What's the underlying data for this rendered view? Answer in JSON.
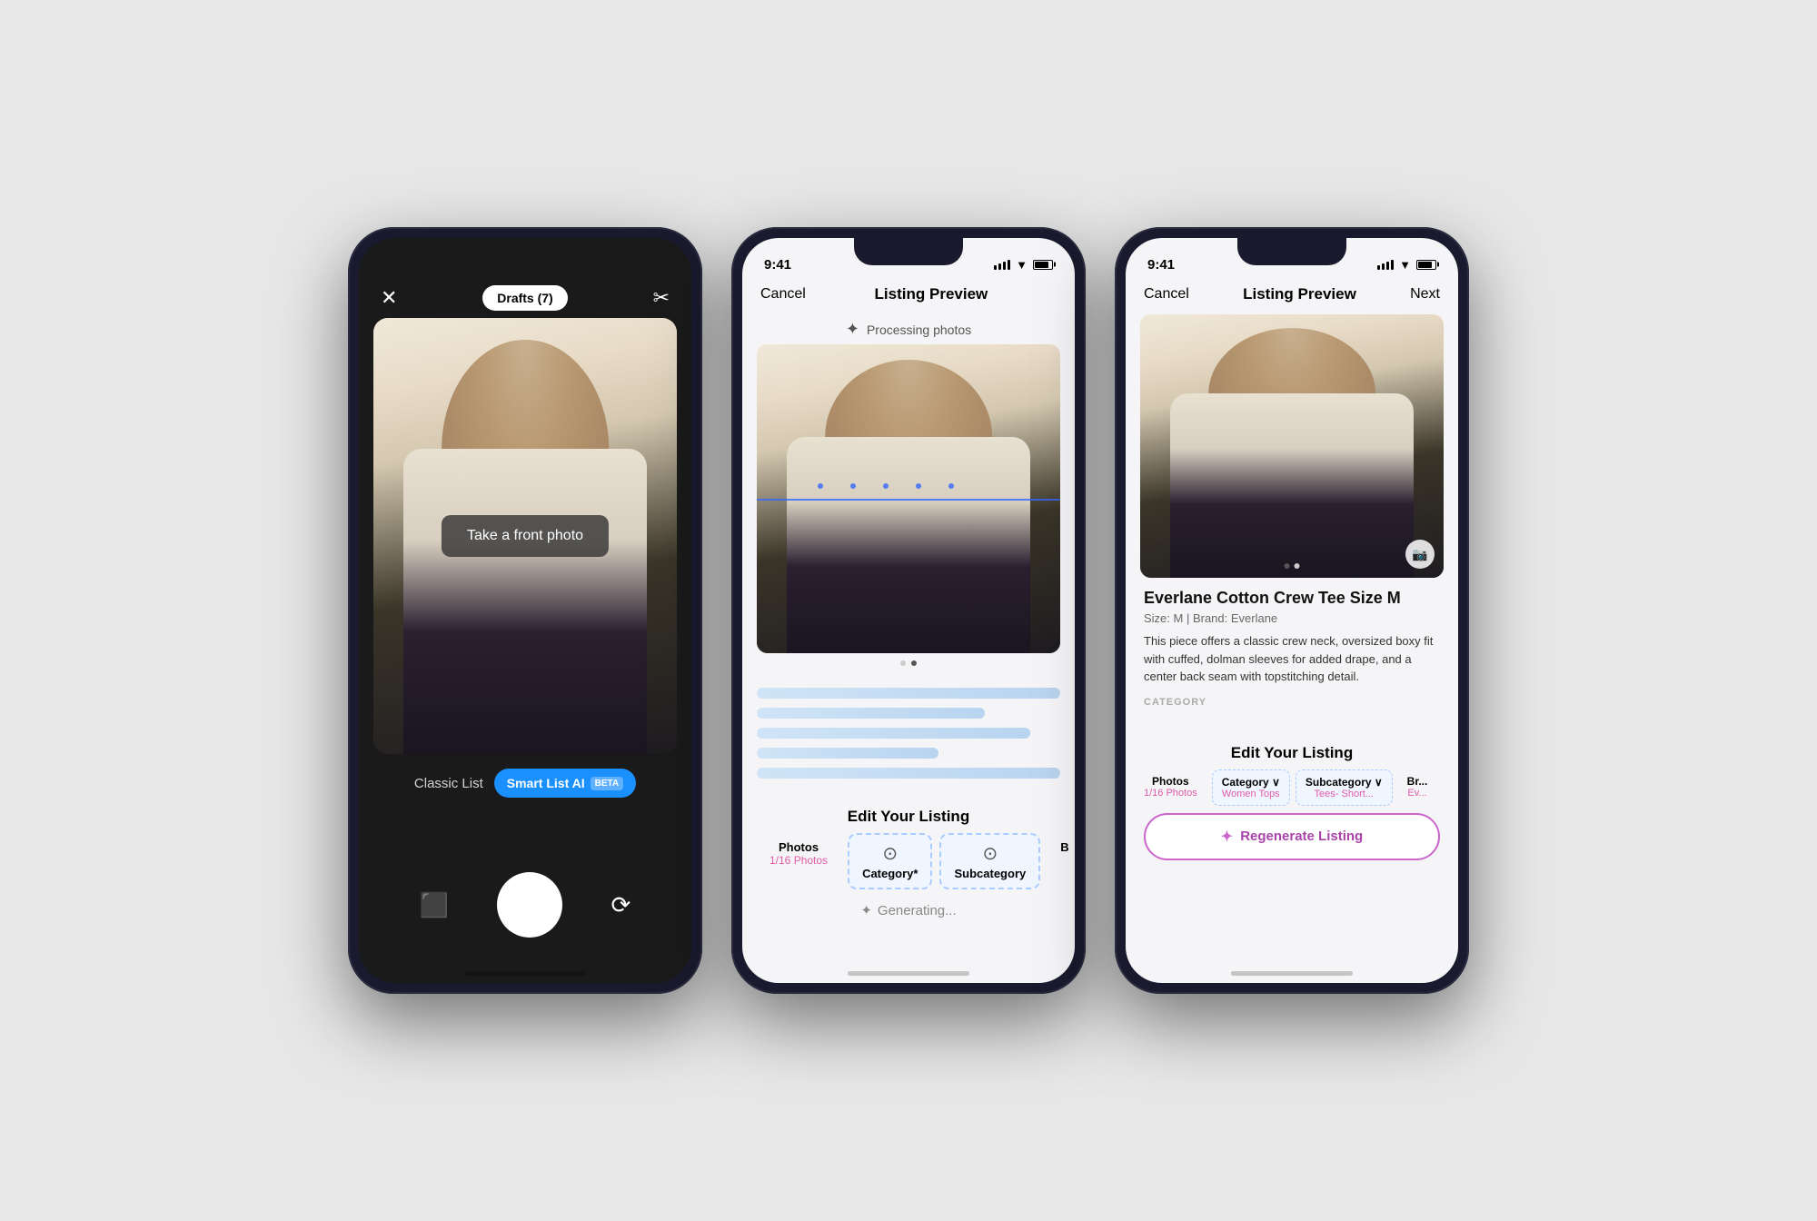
{
  "phones": [
    {
      "id": "camera",
      "theme": "dark",
      "status": {
        "time": "",
        "show_time": false
      },
      "nav": {
        "close_icon": "✕",
        "drafts_label": "Drafts (7)",
        "scissors_icon": "✂"
      },
      "camera": {
        "prompt": "Take a front photo",
        "listing_type_classic": "Classic List",
        "listing_type_smart": "Smart List AI",
        "beta_label": "BETA"
      }
    },
    {
      "id": "processing",
      "theme": "light",
      "status": {
        "time": "9:41"
      },
      "nav": {
        "cancel_label": "Cancel",
        "title": "Listing Preview",
        "next_label": ""
      },
      "processing": {
        "icon": "⟳",
        "label": "Processing photos"
      },
      "edit_section": {
        "title": "Edit Your Listing"
      },
      "tabs": [
        {
          "icon": "⊙",
          "label": "Photos",
          "value": "1/16 Photos",
          "selected": false
        },
        {
          "icon": "⊙",
          "label": "Category*",
          "value": "",
          "selected": true
        },
        {
          "icon": "⊙",
          "label": "Subcategory",
          "value": "",
          "selected": true
        },
        {
          "icon": "⊙",
          "label": "B",
          "value": "",
          "selected": false
        }
      ],
      "generating_label": "Generating..."
    },
    {
      "id": "result",
      "theme": "light",
      "status": {
        "time": "9:41"
      },
      "nav": {
        "cancel_label": "Cancel",
        "title": "Listing Preview",
        "next_label": "Next"
      },
      "product": {
        "title": "Everlane Cotton Crew Tee Size M",
        "meta": "Size: M | Brand: Everlane",
        "description": "This piece offers a classic crew neck, oversized boxy fit with cuffed, dolman sleeves for added drape, and a center back seam with topstitching detail.",
        "category_label": "CATEGORY"
      },
      "edit_section": {
        "title": "Edit Your Listing"
      },
      "tabs": [
        {
          "label": "Photos",
          "value": "1/16 Photos",
          "selected": false,
          "color": "pink"
        },
        {
          "label": "Category",
          "value": "Women Tops",
          "selected": true,
          "color": "pink"
        },
        {
          "label": "Subcategory",
          "value": "Tees- Short...",
          "selected": true,
          "color": "pink"
        },
        {
          "label": "Br",
          "value": "Ev...",
          "selected": false,
          "color": "pink"
        }
      ],
      "regen_button": {
        "icon": "✦",
        "label": "Regenerate Listing"
      }
    }
  ]
}
